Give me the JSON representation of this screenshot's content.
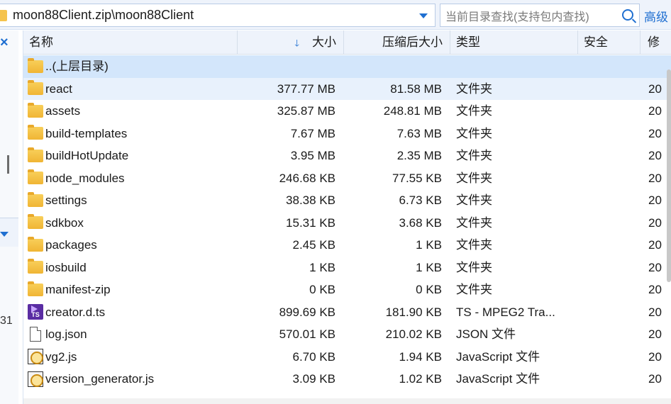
{
  "address": {
    "path": "moon88Client.zip\\moon88Client",
    "icon": "folder-icon"
  },
  "search": {
    "placeholder": "当前目录查找(支持包内查找)",
    "advanced_label": "高级"
  },
  "left_panel": {
    "close_label": "×",
    "partial_number": "31"
  },
  "columns": {
    "name": "名称",
    "size": "大小",
    "compressed": "压缩后大小",
    "type": "类型",
    "security": "安全",
    "modified": "修"
  },
  "rows": [
    {
      "name": "..(上层目录)",
      "size": "",
      "compressed": "",
      "type": "",
      "modified": "",
      "icon": "folder-icon"
    },
    {
      "name": "react",
      "size": "377.77 MB",
      "compressed": "81.58 MB",
      "type": "文件夹",
      "modified": "20",
      "icon": "folder-icon"
    },
    {
      "name": "assets",
      "size": "325.87 MB",
      "compressed": "248.81 MB",
      "type": "文件夹",
      "modified": "20",
      "icon": "folder-icon"
    },
    {
      "name": "build-templates",
      "size": "7.67 MB",
      "compressed": "7.63 MB",
      "type": "文件夹",
      "modified": "20",
      "icon": "folder-icon"
    },
    {
      "name": "buildHotUpdate",
      "size": "3.95 MB",
      "compressed": "2.35 MB",
      "type": "文件夹",
      "modified": "20",
      "icon": "folder-icon"
    },
    {
      "name": "node_modules",
      "size": "246.68 KB",
      "compressed": "77.55 KB",
      "type": "文件夹",
      "modified": "20",
      "icon": "folder-icon"
    },
    {
      "name": "settings",
      "size": "38.38 KB",
      "compressed": "6.73 KB",
      "type": "文件夹",
      "modified": "20",
      "icon": "folder-icon"
    },
    {
      "name": "sdkbox",
      "size": "15.31 KB",
      "compressed": "3.68 KB",
      "type": "文件夹",
      "modified": "20",
      "icon": "folder-icon"
    },
    {
      "name": "packages",
      "size": "2.45 KB",
      "compressed": "1 KB",
      "type": "文件夹",
      "modified": "20",
      "icon": "folder-icon"
    },
    {
      "name": "iosbuild",
      "size": "1 KB",
      "compressed": "1 KB",
      "type": "文件夹",
      "modified": "20",
      "icon": "folder-icon"
    },
    {
      "name": "manifest-zip",
      "size": "0 KB",
      "compressed": "0 KB",
      "type": "文件夹",
      "modified": "20",
      "icon": "folder-icon"
    },
    {
      "name": "creator.d.ts",
      "size": "899.69 KB",
      "compressed": "181.90 KB",
      "type": "TS - MPEG2 Tra...",
      "modified": "20",
      "icon": "ts-file-icon"
    },
    {
      "name": "log.json",
      "size": "570.01 KB",
      "compressed": "210.02 KB",
      "type": "JSON 文件",
      "modified": "20",
      "icon": "document-icon"
    },
    {
      "name": "vg2.js",
      "size": "6.70 KB",
      "compressed": "1.94 KB",
      "type": "JavaScript 文件",
      "modified": "20",
      "icon": "javascript-file-icon"
    },
    {
      "name": "version_generator.js",
      "size": "3.09 KB",
      "compressed": "1.02 KB",
      "type": "JavaScript 文件",
      "modified": "20",
      "icon": "javascript-file-icon"
    }
  ],
  "colors": {
    "accent": "#1f6fd1",
    "header_bg": "#eef3fb",
    "parent_row_bg": "#d3e6fb",
    "selected_row_bg": "#e8f1fc",
    "folder": "#f0b534"
  }
}
